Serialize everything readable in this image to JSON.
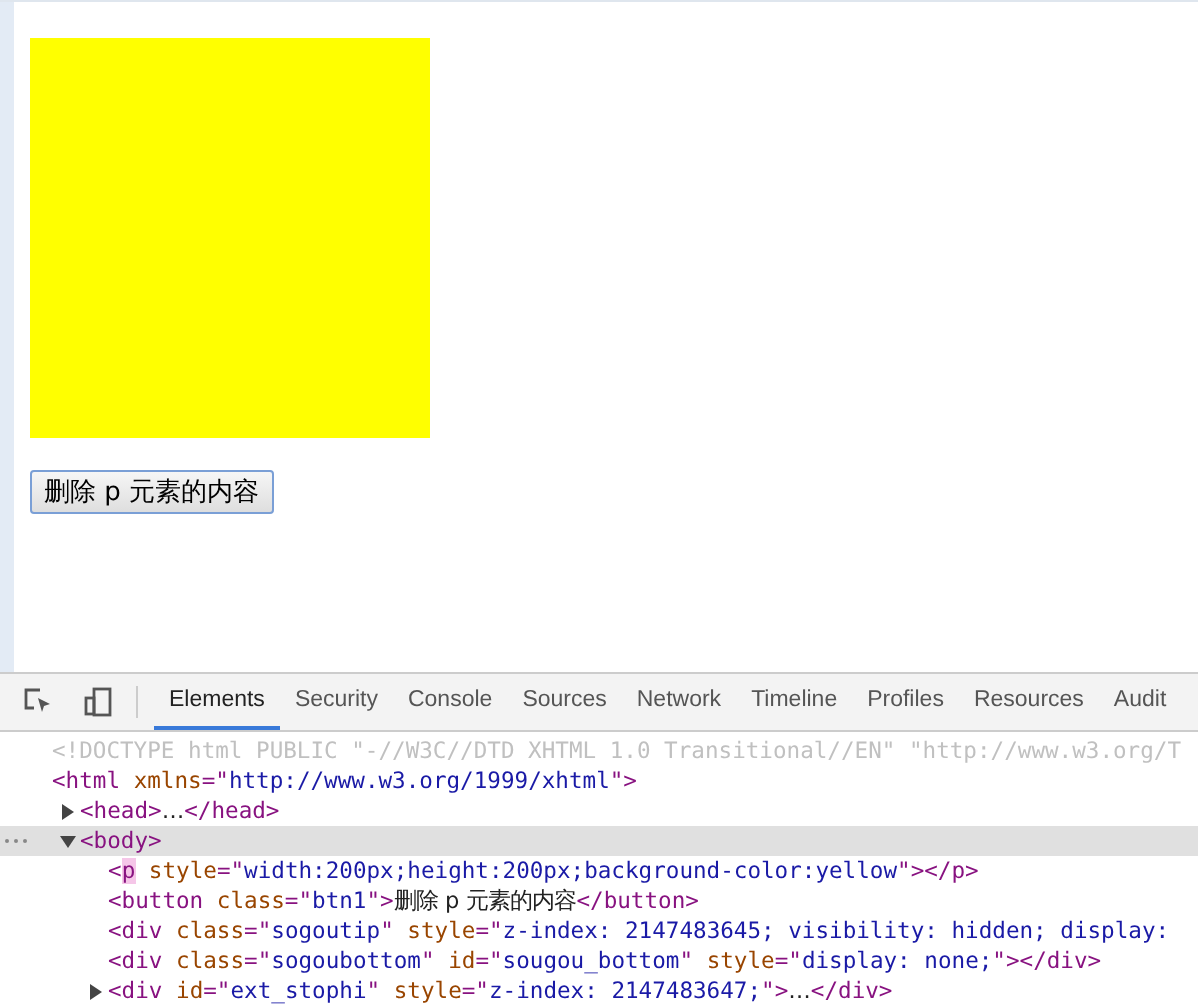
{
  "page": {
    "button": "删除 p 元素的内容"
  },
  "devtools": {
    "tabs": [
      {
        "label": "Elements",
        "selected": true
      },
      {
        "label": "Security",
        "selected": false
      },
      {
        "label": "Console",
        "selected": false
      },
      {
        "label": "Sources",
        "selected": false
      },
      {
        "label": "Network",
        "selected": false
      },
      {
        "label": "Timeline",
        "selected": false
      },
      {
        "label": "Profiles",
        "selected": false
      },
      {
        "label": "Resources",
        "selected": false
      },
      {
        "label": "Audit",
        "selected": false
      }
    ],
    "tree": [
      {
        "selected": false,
        "parts": [
          {
            "kind": "doctype",
            "text": "<!DOCTYPE html PUBLIC \"-//W3C//DTD XHTML 1.0 Transitional//EN\" \"http://www.w3.org/T"
          }
        ]
      },
      {
        "selected": false,
        "parts": [
          {
            "kind": "tag",
            "text": "<html"
          },
          {
            "kind": "attr",
            "text": " xmlns"
          },
          {
            "kind": "tag",
            "text": "=\""
          },
          {
            "kind": "value",
            "text": "http://www.w3.org/1999/xhtml"
          },
          {
            "kind": "tag",
            "text": "\">"
          }
        ],
        "children": [
          {
            "expanded": false,
            "selected": false,
            "parts": [
              {
                "kind": "tag",
                "text": "<head>"
              },
              {
                "kind": "text",
                "text": "…"
              },
              {
                "kind": "tag",
                "text": "</head>"
              }
            ]
          },
          {
            "expanded": true,
            "selected": true,
            "parts": [
              {
                "kind": "tag",
                "text": "<body>"
              }
            ],
            "children": [
              {
                "selected": false,
                "parts": [
                  {
                    "kind": "tag",
                    "text": "<"
                  },
                  {
                    "kind": "match",
                    "text": "p"
                  },
                  {
                    "kind": "attr",
                    "text": " style"
                  },
                  {
                    "kind": "tag",
                    "text": "=\""
                  },
                  {
                    "kind": "value",
                    "text": "width:200px;height:200px;background-color:yellow"
                  },
                  {
                    "kind": "tag",
                    "text": "\"></p>"
                  }
                ]
              },
              {
                "selected": false,
                "parts": [
                  {
                    "kind": "tag",
                    "text": "<button"
                  },
                  {
                    "kind": "attr",
                    "text": " class"
                  },
                  {
                    "kind": "tag",
                    "text": "=\""
                  },
                  {
                    "kind": "value",
                    "text": "btn1"
                  },
                  {
                    "kind": "tag",
                    "text": "\">"
                  },
                  {
                    "kind": "text",
                    "text": "删除 p 元素的内容"
                  },
                  {
                    "kind": "tag",
                    "text": "</button>"
                  }
                ]
              },
              {
                "selected": false,
                "parts": [
                  {
                    "kind": "tag",
                    "text": "<div"
                  },
                  {
                    "kind": "attr",
                    "text": " class"
                  },
                  {
                    "kind": "tag",
                    "text": "=\""
                  },
                  {
                    "kind": "value",
                    "text": "sogoutip"
                  },
                  {
                    "kind": "tag",
                    "text": "\""
                  },
                  {
                    "kind": "attr",
                    "text": " style"
                  },
                  {
                    "kind": "tag",
                    "text": "=\""
                  },
                  {
                    "kind": "value",
                    "text": "z-index: 2147483645; visibility: hidden; display:"
                  }
                ]
              },
              {
                "selected": false,
                "parts": [
                  {
                    "kind": "tag",
                    "text": "<div"
                  },
                  {
                    "kind": "attr",
                    "text": " class"
                  },
                  {
                    "kind": "tag",
                    "text": "=\""
                  },
                  {
                    "kind": "value",
                    "text": "sogoubottom"
                  },
                  {
                    "kind": "tag",
                    "text": "\""
                  },
                  {
                    "kind": "attr",
                    "text": " id"
                  },
                  {
                    "kind": "tag",
                    "text": "=\""
                  },
                  {
                    "kind": "value",
                    "text": "sougou_bottom"
                  },
                  {
                    "kind": "tag",
                    "text": "\""
                  },
                  {
                    "kind": "attr",
                    "text": " style"
                  },
                  {
                    "kind": "tag",
                    "text": "=\""
                  },
                  {
                    "kind": "value",
                    "text": "display: none;"
                  },
                  {
                    "kind": "tag",
                    "text": "\"></div>"
                  }
                ]
              },
              {
                "expanded": false,
                "selected": false,
                "parts": [
                  {
                    "kind": "tag",
                    "text": "<div"
                  },
                  {
                    "kind": "attr",
                    "text": " id"
                  },
                  {
                    "kind": "tag",
                    "text": "=\""
                  },
                  {
                    "kind": "value",
                    "text": "ext_stophi"
                  },
                  {
                    "kind": "tag",
                    "text": "\""
                  },
                  {
                    "kind": "attr",
                    "text": " style"
                  },
                  {
                    "kind": "tag",
                    "text": "=\""
                  },
                  {
                    "kind": "value",
                    "text": "z-index: 2147483647;"
                  },
                  {
                    "kind": "tag",
                    "text": "\">"
                  },
                  {
                    "kind": "text",
                    "text": "…"
                  },
                  {
                    "kind": "tag",
                    "text": "</div>"
                  }
                ]
              }
            ]
          }
        ]
      }
    ]
  }
}
